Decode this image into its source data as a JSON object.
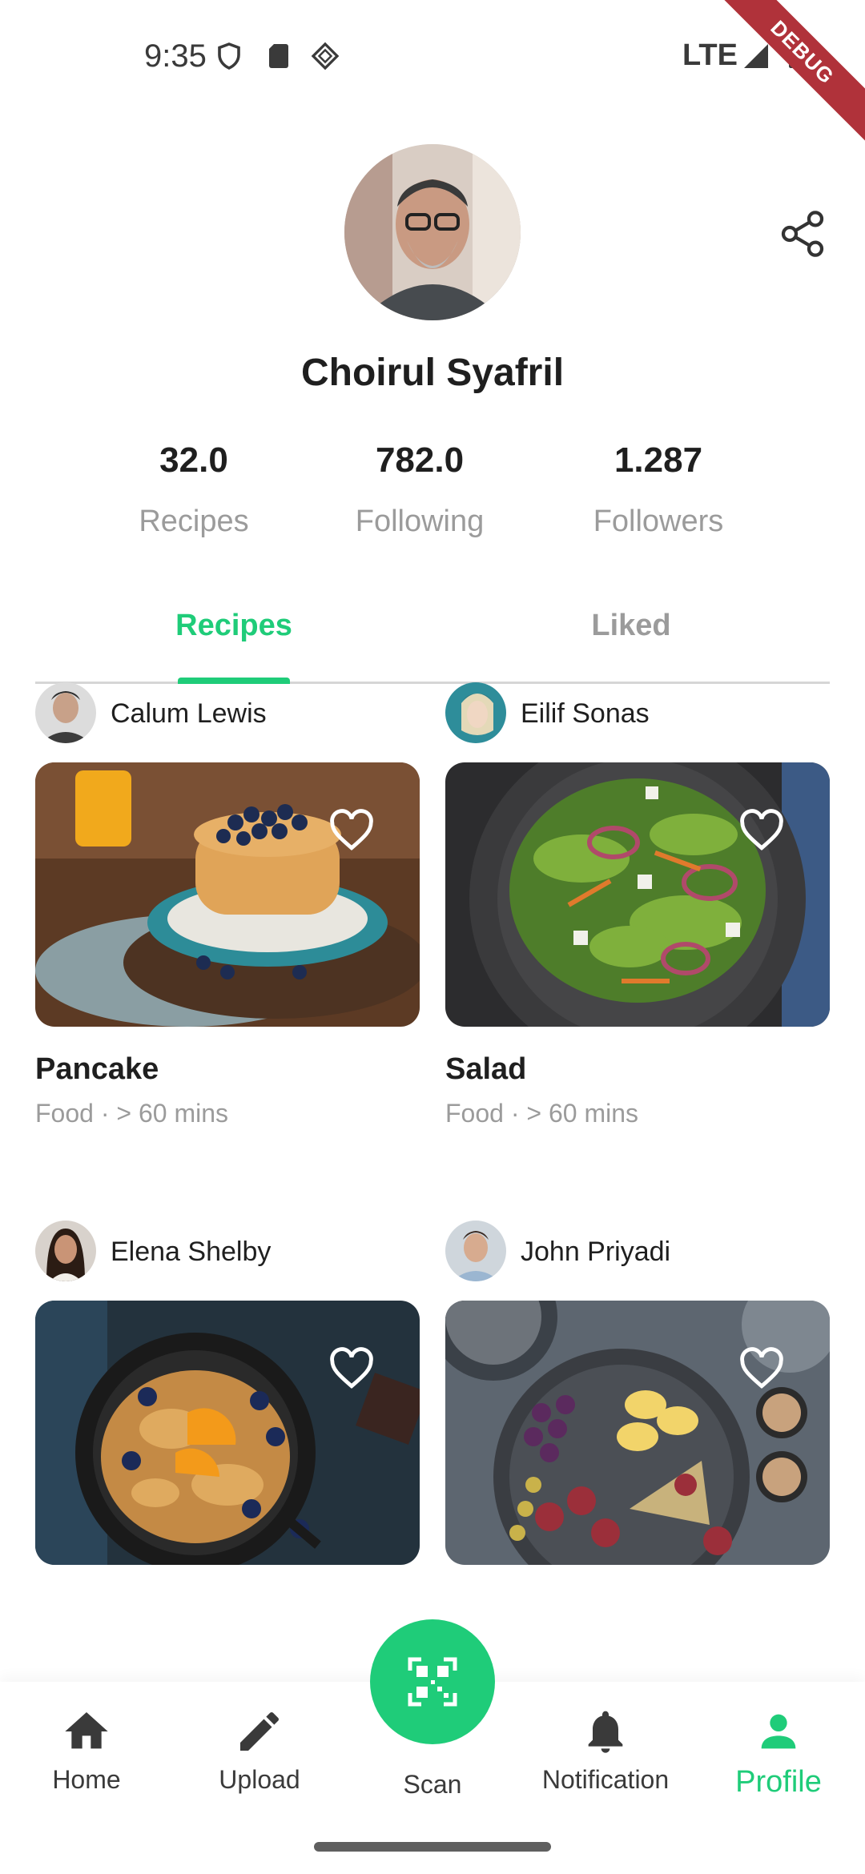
{
  "status_bar": {
    "time": "9:35",
    "network": "LTE",
    "icons": [
      "shield-icon",
      "sd-card-icon",
      "diamond-icon",
      "signal-icon",
      "battery-icon"
    ],
    "debug_label": "DEBUG"
  },
  "profile": {
    "name": "Choirul Syafril",
    "avatar_icon": "profile-avatar",
    "share_icon": "share-icon"
  },
  "stats": [
    {
      "value": "32.0",
      "label": "Recipes"
    },
    {
      "value": "782.0",
      "label": "Following"
    },
    {
      "value": "1.287",
      "label": "Followers"
    }
  ],
  "tabs": {
    "recipes": "Recipes",
    "liked": "Liked",
    "active": "Recipes"
  },
  "recipes": [
    {
      "author": "Calum Lewis",
      "title": "Pancake",
      "meta": "Food · > 60 mins"
    },
    {
      "author": "Eilif Sonas",
      "title": "Salad",
      "meta": "Food · > 60 mins"
    },
    {
      "author": "Elena Shelby",
      "title": "",
      "meta": ""
    },
    {
      "author": "John Priyadi",
      "title": "",
      "meta": ""
    }
  ],
  "bottom_nav": {
    "home": "Home",
    "upload": "Upload",
    "scan": "Scan",
    "notification": "Notification",
    "profile": "Profile",
    "active": "Profile"
  },
  "colors": {
    "accent": "#1fcc79",
    "muted_text": "#9b9b9b",
    "primary_text": "#1f1f1f",
    "debug_ribbon": "#b0323a"
  }
}
